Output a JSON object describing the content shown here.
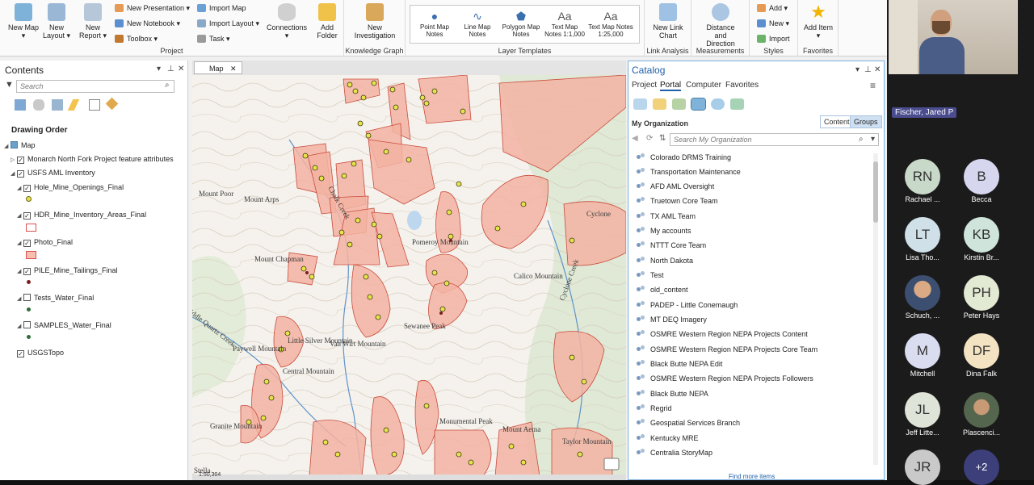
{
  "ribbon": {
    "groups": {
      "project": "Project",
      "knowledge": "Knowledge Graph",
      "templates": "Layer Templates",
      "link": "Link Analysis",
      "measure": "Measurements",
      "styles": "Styles",
      "favorites": "Favorites"
    },
    "new_map": "New Map ▾",
    "new_layout": "New Layout ▾",
    "new_report": "New Report ▾",
    "new_presentation": "New Presentation ▾",
    "new_notebook": "New Notebook ▾",
    "toolbox": "Toolbox ▾",
    "import_map": "Import Map",
    "import_layout": "Import Layout ▾",
    "task": "Task ▾",
    "connections": "Connections ▾",
    "add_folder": "Add Folder",
    "new_investigation": "New Investigation",
    "point_map_notes": "Point Map Notes",
    "line_map_notes": "Line Map Notes",
    "polygon_map_notes": "Polygon Map Notes",
    "text_map_1000": "Text Map Notes 1:1,000",
    "text_map_25000": "Text Map Notes 1:25,000",
    "new_link_chart": "New Link Chart",
    "distance_direction": "Distance and Direction",
    "add": "Add ▾",
    "new": "New ▾",
    "import": "Import",
    "add_item": "Add Item ▾"
  },
  "contents": {
    "title": "Contents",
    "search_placeholder": "Search",
    "section": "Drawing Order",
    "layers": [
      {
        "label": "Map",
        "checked": true
      },
      {
        "label": "Monarch North Fork Project feature attributes",
        "checked": true
      },
      {
        "label": "USFS AML Inventory",
        "checked": true
      },
      {
        "label": "Hole_Mine_Openings_Final",
        "checked": true
      },
      {
        "label": "HDR_Mine_Inventory_Areas_Final",
        "checked": true
      },
      {
        "label": "Photo_Final",
        "checked": true
      },
      {
        "label": "PILE_Mine_Tailings_Final",
        "checked": true
      },
      {
        "label": "Tests_Water_Final",
        "checked": false
      },
      {
        "label": "SAMPLES_Water_Final",
        "checked": false
      },
      {
        "label": "USGSTopo",
        "checked": true
      }
    ]
  },
  "map": {
    "tab": "Map",
    "labels": [
      "Mount Poor",
      "Mount Arps",
      "Mount Chapman",
      "Middle Quartz Creek",
      "Chalk Creek",
      "Pomeroy Mountain",
      "Calico Mountain",
      "Cyclone Creek",
      "Cyclone",
      "Sewanee Peak",
      "Little Silver Mountain",
      "Van Wirt Mountain",
      "Paywell Mountain",
      "Central Mountain",
      "Granite Mountain",
      "Monumental Peak",
      "Mount Aetna",
      "Taylor Mountain",
      "Stella",
      "1:50,304"
    ]
  },
  "catalog": {
    "title": "Catalog",
    "tabs": [
      "Project",
      "Portal",
      "Computer",
      "Favorites"
    ],
    "section": "My Organization",
    "content_btn": "Content",
    "groups_btn": "Groups",
    "search_placeholder": "Search My Organization",
    "items": [
      "Colorado DRMS Training",
      "Transportation Maintenance",
      "AFD AML Oversight",
      "Truetown Core Team",
      "TX AML Team",
      "My accounts",
      "NTTT Core Team",
      "North Dakota",
      "Test",
      "old_content",
      "PADEP - Little Conemaugh",
      "MT DEQ Imagery",
      "OSMRE Western Region NEPA Projects Content",
      "OSMRE Western Region NEPA Projects Core Team",
      "Black Butte NEPA Edit",
      "OSMRE Western Region NEPA Projects Followers",
      "Black Butte NEPA",
      "Regrid",
      "Geospatial Services Branch",
      "Kentucky MRE",
      "Centralia StoryMap"
    ],
    "find_more": "Find more items"
  },
  "meeting": {
    "speaker": "Fischer, Jared P",
    "participants": [
      {
        "initials": "RN",
        "name": "Rachael ...",
        "color": "#c9d9c9"
      },
      {
        "initials": "B",
        "name": "Becca",
        "color": "#d6d7ef"
      },
      {
        "initials": "LT",
        "name": "Lisa Tho...",
        "color": "#cfe0e8"
      },
      {
        "initials": "KB",
        "name": "Kirstin Br...",
        "color": "#cfe5dc"
      },
      {
        "initials": "",
        "name": "Schuch, ...",
        "color": "#9a7d5b"
      },
      {
        "initials": "PH",
        "name": "Peter Hays",
        "color": "#e2ead3"
      },
      {
        "initials": "M",
        "name": "Mitchell",
        "color": "#dadcf0"
      },
      {
        "initials": "DF",
        "name": "Dina Falk",
        "color": "#f3e3c2"
      },
      {
        "initials": "JL",
        "name": "Jeff Litte...",
        "color": "#dfe4d8"
      },
      {
        "initials": "",
        "name": "Plascenci...",
        "color": "#6d7b6a"
      },
      {
        "initials": "JR",
        "name": "",
        "color": "#c9c9c9"
      },
      {
        "initials": "+2",
        "name": "",
        "color": "#3d3f7a"
      }
    ]
  }
}
